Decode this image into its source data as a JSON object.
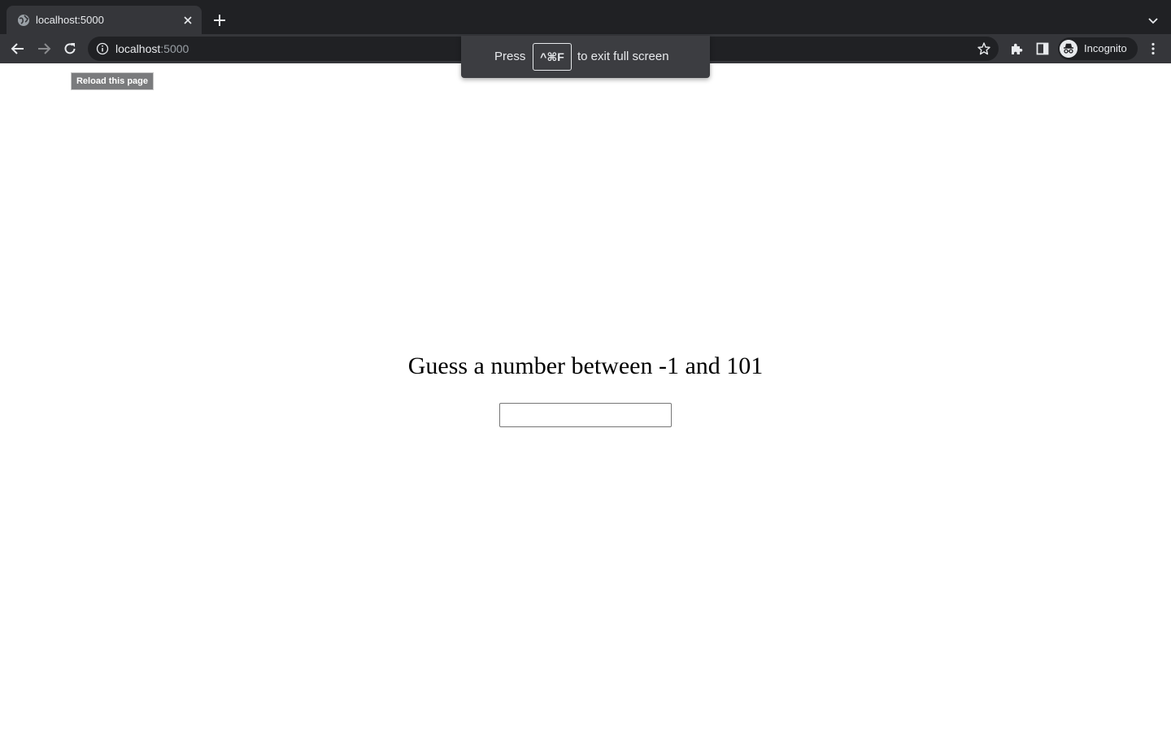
{
  "browser": {
    "tab": {
      "title": "localhost:5000",
      "favicon_icon": "globe-icon",
      "close_icon": "close-icon"
    },
    "new_tab_icon": "plus-icon",
    "tab_search_icon": "chevron-down-icon",
    "toolbar": {
      "back_icon": "arrow-left-icon",
      "forward_icon": "arrow-right-icon",
      "reload_icon": "reload-icon",
      "extensions_icon": "puzzle-icon",
      "side_panel_icon": "side-panel-icon",
      "menu_icon": "kebab-menu-icon"
    },
    "omnibox": {
      "host": "localhost",
      "port": ":5000",
      "info_icon": "info-icon",
      "bookmark_icon": "star-icon"
    },
    "profile": {
      "label": "Incognito",
      "icon": "incognito-icon"
    },
    "fullscreen_bubble": {
      "press": "Press",
      "key": "^⌘F",
      "rest": "to exit full screen"
    },
    "tooltip": {
      "text": "Reload this page"
    }
  },
  "page": {
    "heading": "Guess a number between -1 and 101",
    "guess_input": {
      "value": "",
      "placeholder": ""
    }
  }
}
